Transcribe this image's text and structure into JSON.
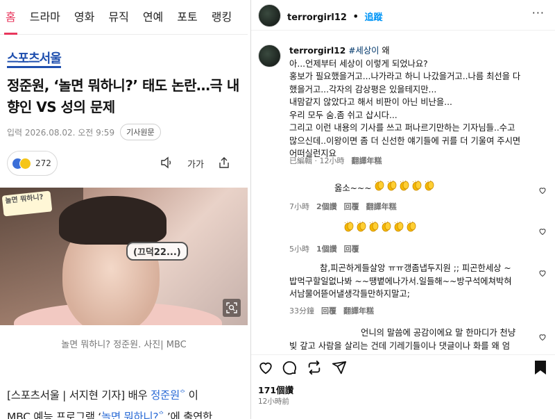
{
  "news": {
    "nav": [
      "홈",
      "드라마",
      "영화",
      "뮤직",
      "연예",
      "포토",
      "랭킹"
    ],
    "active_nav": 0,
    "logo": "스포츠서울",
    "headline": "정준원, ‘놀면 뭐하니?’ 태도 논란…극 내향인 VS 성의 문제",
    "date": "입력 2026.08.02. 오전 9:59",
    "source_button": "기사원문",
    "reaction_count": "272",
    "font_size_icon": "가가",
    "photo_logo": "놀면 뭐하니?",
    "photo_text": "(끄덕22...)",
    "photo_caption": "놀면 뭐하니? 정준원. 사진| MBC",
    "body_line1": "[스포츠서울 | 서지현 기자] 배우 ",
    "body_link1": "정준원",
    "body_line1_end": " 이",
    "body_line2": "MBC 예능 프로그램 ‘",
    "body_link2": "놀면 뭐하니?",
    "body_line2_end": " ’에 출연한"
  },
  "instagram": {
    "username": "terrorgirl12",
    "follow_label": "追蹤",
    "caption": {
      "user": "terrorgirl12",
      "hashtag": "#세상이",
      "first_word": " 왜",
      "lines": [
        "아...언제부터 세상이 이렇게 되었나요?",
        "홍보가 필요했을거고...나가라고 하니 나갔을거고..나름 최선을 다",
        "했을거고...각자의 감상평은 있을테지만...",
        "내맘같지 않았다고 해서 비판이 아닌 비난을...",
        "우리 모두 숨.좀 쉬고 삽시다...",
        "그리고 이런 내용의 기사를 쓰고 퍼나르기만하는 기자님들..수고",
        "많으신데..이왕이면 좀 더 신선한 얘기들에 귀를 더 기울여 주시면",
        "어떠실런지요"
      ],
      "edited": "已編輯",
      "time": "12小時",
      "translate": "翻譯年糕"
    },
    "comments": [
      {
        "text": "옳소~~~",
        "clap_count": 5,
        "time": "7小時",
        "likes": "2個讚",
        "reply": "回覆",
        "translate": "翻譯年糕"
      },
      {
        "text": "",
        "clap_count": 6,
        "time": "5小時",
        "likes": "1個讚",
        "reply": "回覆",
        "translate": ""
      },
      {
        "lines": [
          "참,피곤하게들살앙 ㅠㅠ갱좀냅두지원 ;; 피곤한세상 ~",
          "밥먹구할일없나봐 ~~땡볕에나가서.일들해~~방구석에쳐박혀",
          "서남물어뜯어낼생각들만하지말고;"
        ],
        "time": "33分鐘",
        "likes": "",
        "reply": "回覆",
        "translate": "翻譯年糕"
      },
      {
        "lines": [
          "언니의 말씀에 공감이에요 말 한마디가 천냥",
          "빚 갚고 사람을 살리는 건데 기레기들이나 댓글이나 화를 왜 엄"
        ]
      }
    ],
    "likes": "171個讚",
    "post_time": "12小時前"
  }
}
